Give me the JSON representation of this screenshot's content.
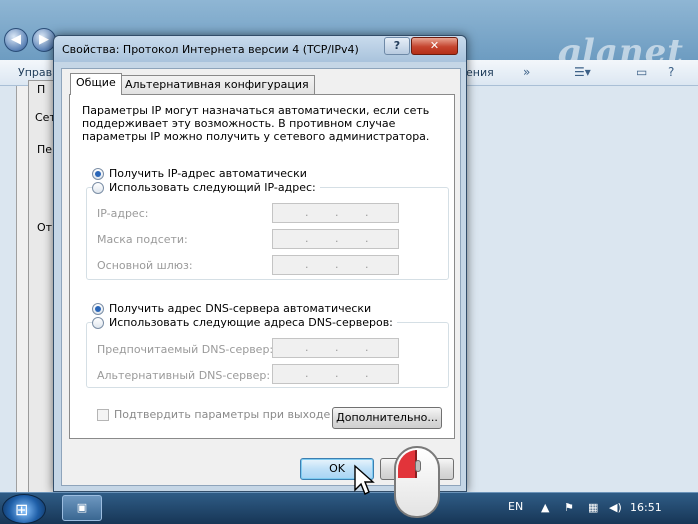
{
  "background": {
    "toolbar_left": "Управ",
    "toolbar_right": "ения",
    "logo": "qlanet",
    "panel_fragments": [
      "П",
      "Сет",
      "Пе",
      "От"
    ]
  },
  "dialog": {
    "title": "Свойства: Протокол Интернета версии 4 (TCP/IPv4)",
    "help_label": "?",
    "close_label": "✕",
    "tabs": [
      "Общие",
      "Альтернативная конфигурация"
    ],
    "description": "Параметры IP могут назначаться автоматически, если сеть поддерживает эту возможность. В противном случае параметры IP можно получить у сетевого администратора.",
    "ip_auto_label": "Получить IP-адрес автоматически",
    "ip_manual_label": "Использовать следующий IP-адрес:",
    "ip_fields": [
      "IP-адрес:",
      "Маска подсети:",
      "Основной шлюз:"
    ],
    "dns_auto_label": "Получить адрес DNS-сервера автоматически",
    "dns_manual_label": "Использовать следующие адреса DNS-серверов:",
    "dns_fields": [
      "Предпочитаемый DNS-сервер:",
      "Альтернативный DNS-сервер:"
    ],
    "ip_placeholder_dots": ".",
    "validate_label": "Подтвердить параметры при выходе",
    "advanced_label": "Дополнительно...",
    "ok_label": "OK",
    "cancel_label": "Отмена"
  },
  "taskbar": {
    "language": "EN",
    "clock": "16:51"
  },
  "colors": {
    "accent": "#2a66b8",
    "close": "#c5442e",
    "mouse_button": "#e2343a"
  },
  "icons": [
    "back-icon",
    "forward-icon",
    "help-icon",
    "close-icon",
    "windows-start-icon",
    "network-icon",
    "volume-icon",
    "mouse-icon",
    "cursor-icon"
  ]
}
